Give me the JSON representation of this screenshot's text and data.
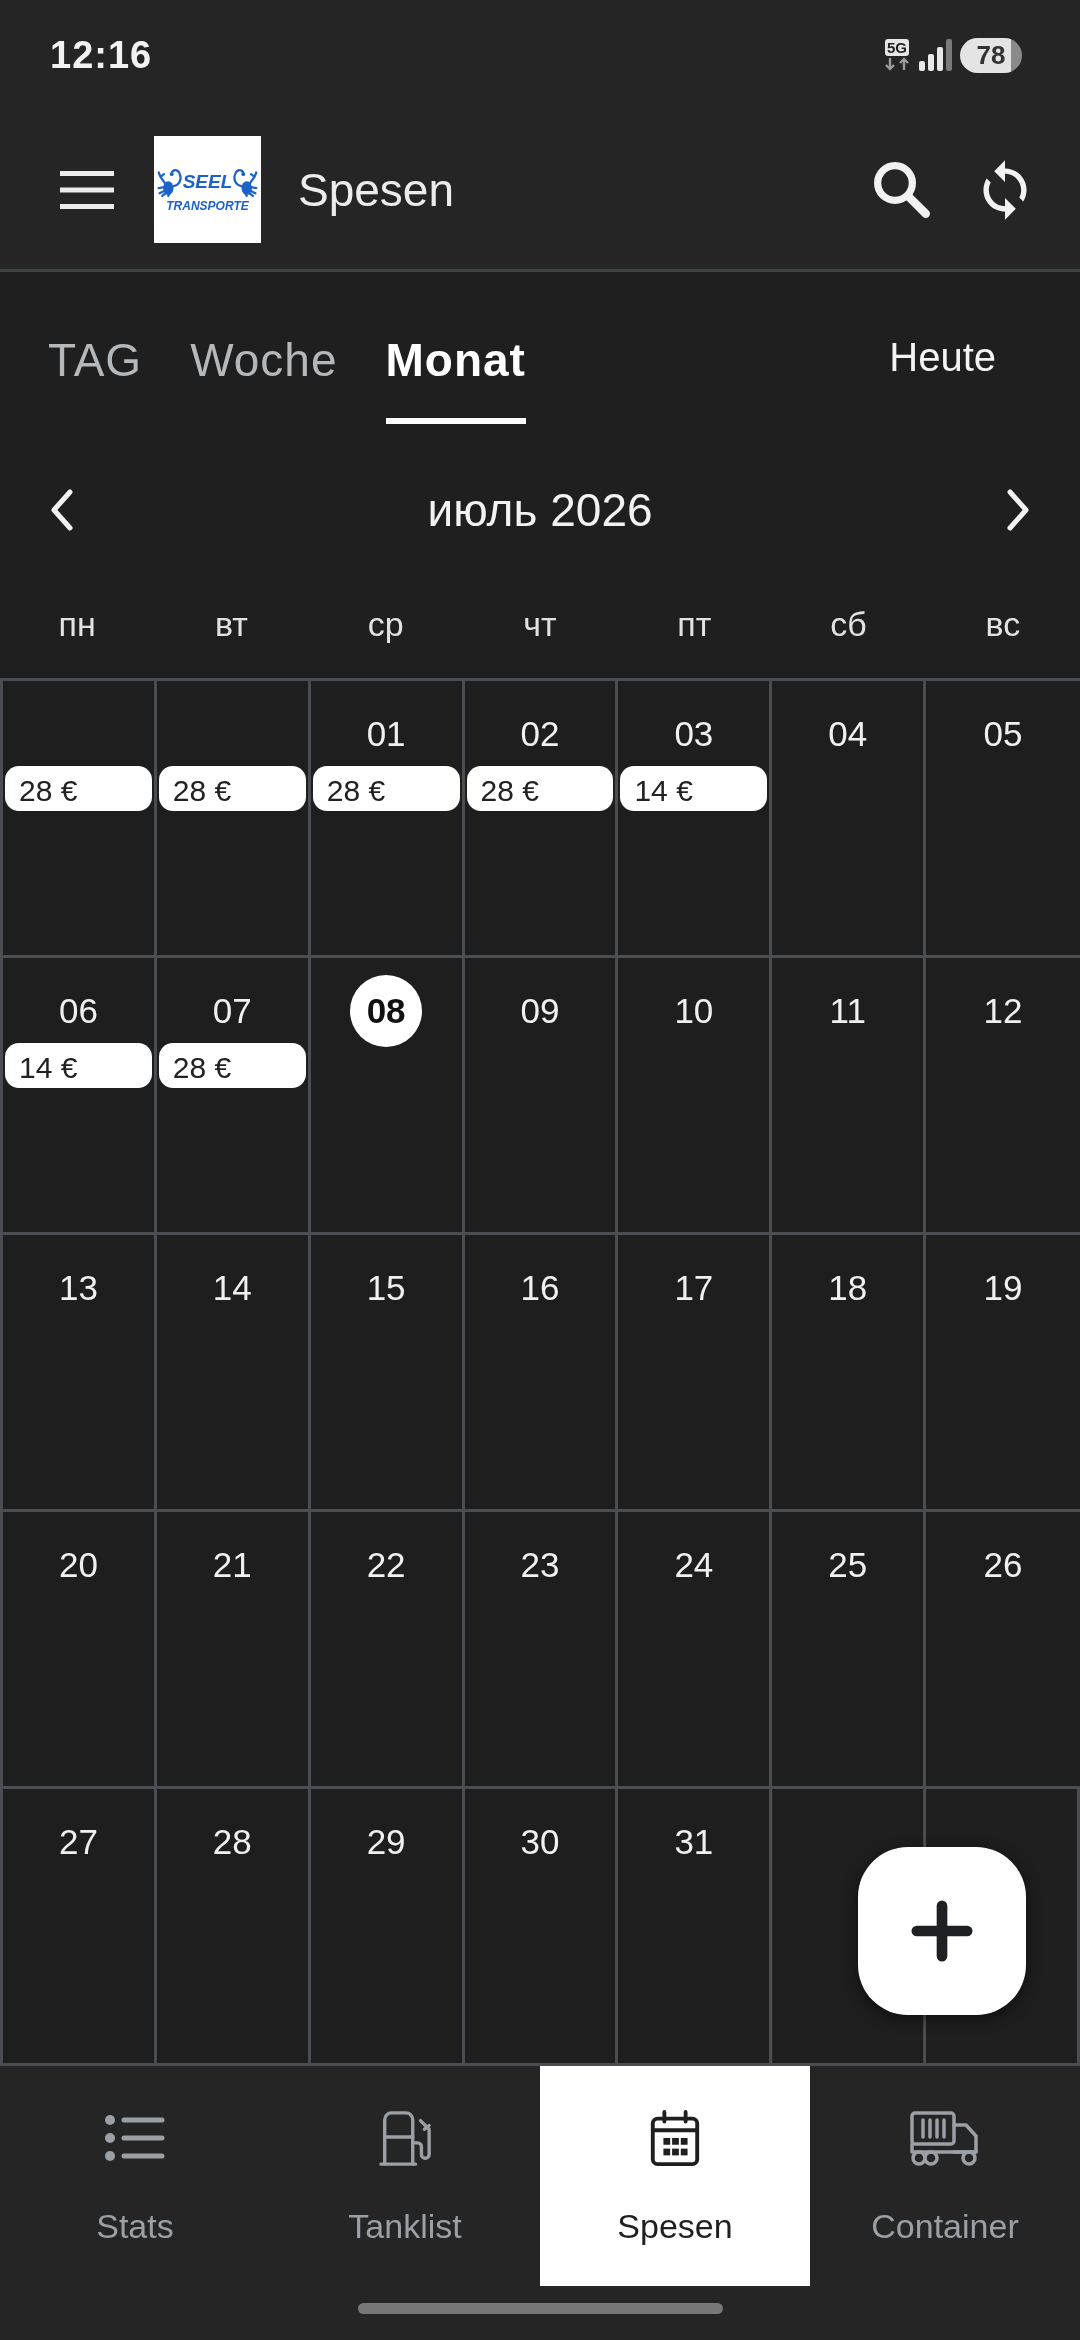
{
  "status_bar": {
    "time": "12:16",
    "network": "5G",
    "battery": "78"
  },
  "app_bar": {
    "logo": {
      "line_1": "SEEL",
      "line_2": "TRANSPORTE"
    },
    "title": "Spesen"
  },
  "view_tabs": [
    {
      "label": "TAG",
      "selected": false
    },
    {
      "label": "Woche",
      "selected": false
    },
    {
      "label": "Monat",
      "selected": true
    }
  ],
  "today_button": "Heute",
  "month_nav": {
    "title": "июль 2026"
  },
  "weekdays": [
    "пн",
    "вт",
    "ср",
    "чт",
    "пт",
    "сб",
    "вс"
  ],
  "weeks": [
    [
      {
        "amount": "28 €",
        "today": false
      },
      {
        "amount": "28 €",
        "today": false
      },
      {
        "day": "01",
        "amount": "28 €",
        "today": false
      },
      {
        "day": "02",
        "amount": "28 €",
        "today": false
      },
      {
        "day": "03",
        "amount": "14 €",
        "today": false
      },
      {
        "day": "04",
        "today": false
      },
      {
        "day": "05",
        "today": false
      }
    ],
    [
      {
        "day": "06",
        "amount": "14 €",
        "today": false
      },
      {
        "day": "07",
        "amount": "28 €",
        "today": false
      },
      {
        "day": "08",
        "today": true
      },
      {
        "day": "09",
        "today": false
      },
      {
        "day": "10",
        "today": false
      },
      {
        "day": "11",
        "today": false
      },
      {
        "day": "12",
        "today": false
      }
    ],
    [
      {
        "day": "13",
        "today": false
      },
      {
        "day": "14",
        "today": false
      },
      {
        "day": "15",
        "today": false
      },
      {
        "day": "16",
        "today": false
      },
      {
        "day": "17",
        "today": false
      },
      {
        "day": "18",
        "today": false
      },
      {
        "day": "19",
        "today": false
      }
    ],
    [
      {
        "day": "20",
        "today": false
      },
      {
        "day": "21",
        "today": false
      },
      {
        "day": "22",
        "today": false
      },
      {
        "day": "23",
        "today": false
      },
      {
        "day": "24",
        "today": false
      },
      {
        "day": "25",
        "today": false
      },
      {
        "day": "26",
        "today": false
      }
    ],
    [
      {
        "day": "27",
        "today": false
      },
      {
        "day": "28",
        "today": false
      },
      {
        "day": "29",
        "today": false
      },
      {
        "day": "30",
        "today": false
      },
      {
        "day": "31",
        "today": false
      }
    ]
  ],
  "bottom_nav": [
    {
      "label": "Stats",
      "selected": false
    },
    {
      "label": "Tanklist",
      "selected": false
    },
    {
      "label": "Spesen",
      "selected": true
    },
    {
      "label": "Container",
      "selected": false
    }
  ]
}
